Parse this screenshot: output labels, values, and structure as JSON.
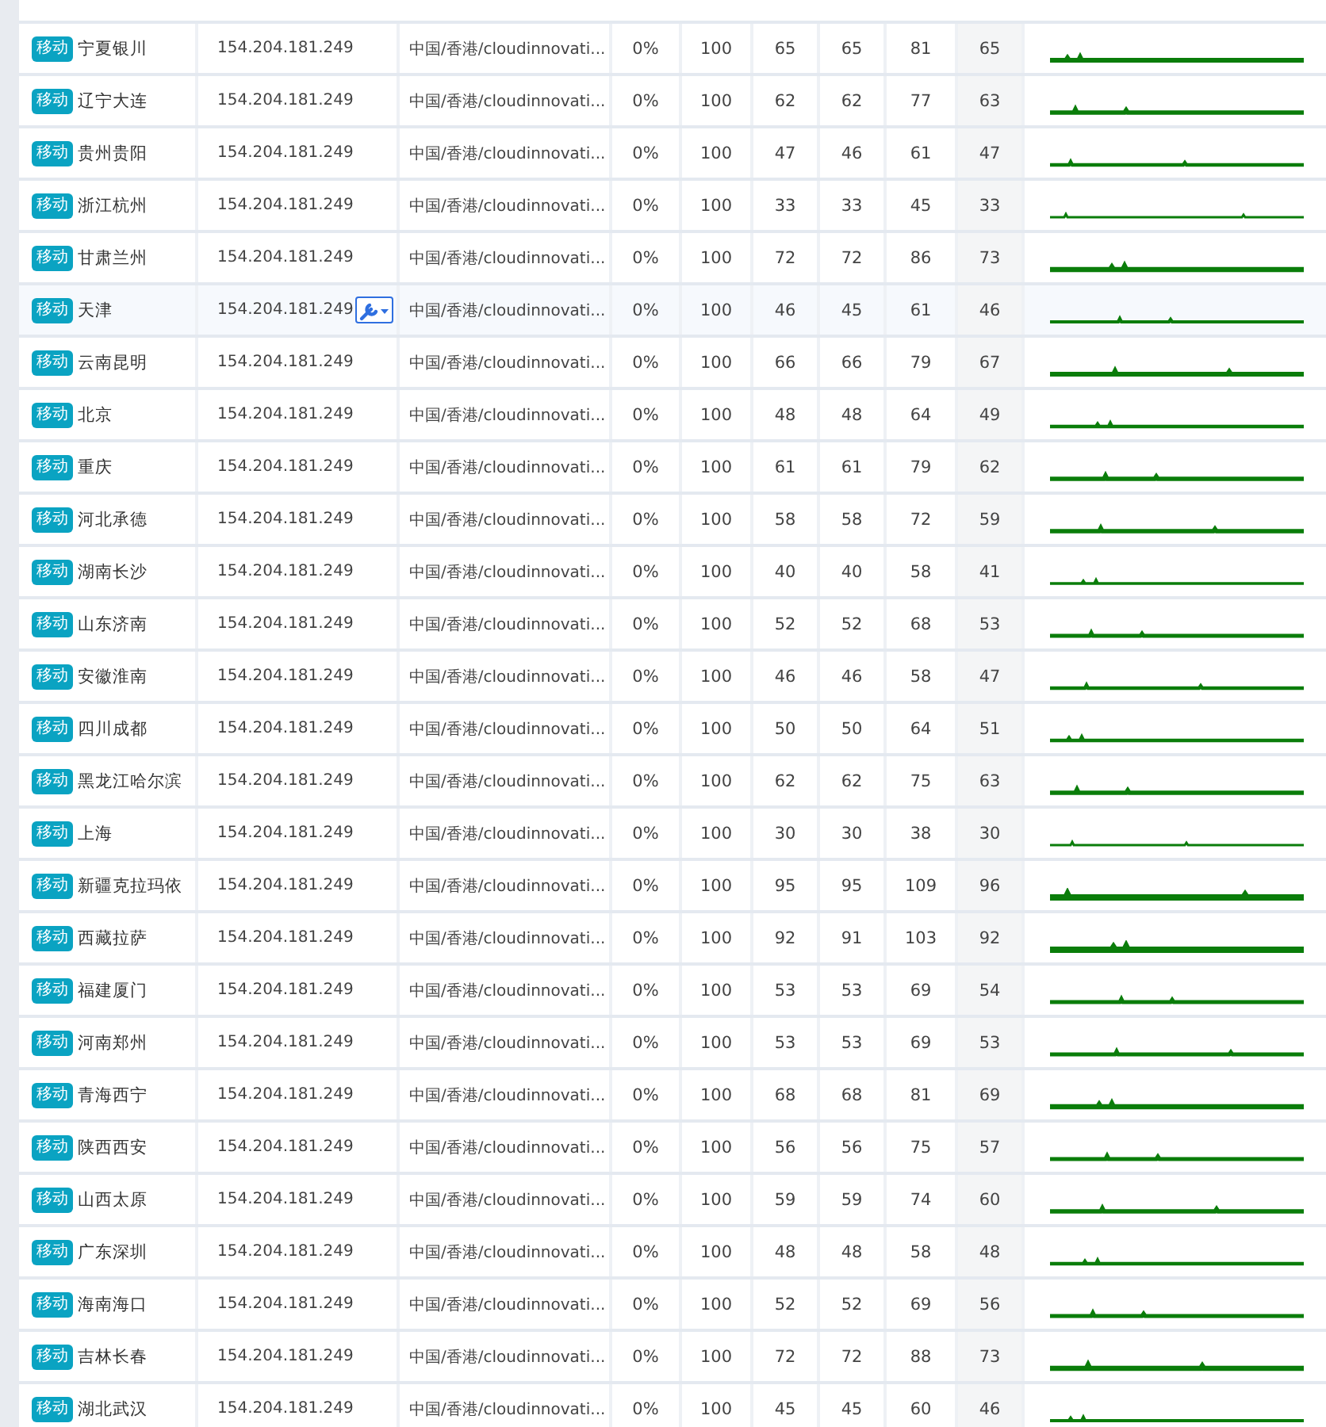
{
  "rows": [
    {
      "carrier": "移动",
      "city": "宁夏银川",
      "ip": "154.204.181.249",
      "location": "中国/香港/cloudinnovati...",
      "values": [
        "0%",
        "100",
        "65",
        "65",
        "81",
        "65"
      ],
      "hovered": false
    },
    {
      "carrier": "移动",
      "city": "辽宁大连",
      "ip": "154.204.181.249",
      "location": "中国/香港/cloudinnovati...",
      "values": [
        "0%",
        "100",
        "62",
        "62",
        "77",
        "63"
      ],
      "hovered": false
    },
    {
      "carrier": "移动",
      "city": "贵州贵阳",
      "ip": "154.204.181.249",
      "location": "中国/香港/cloudinnovati...",
      "values": [
        "0%",
        "100",
        "47",
        "46",
        "61",
        "47"
      ],
      "hovered": false
    },
    {
      "carrier": "移动",
      "city": "浙江杭州",
      "ip": "154.204.181.249",
      "location": "中国/香港/cloudinnovati...",
      "values": [
        "0%",
        "100",
        "33",
        "33",
        "45",
        "33"
      ],
      "hovered": false
    },
    {
      "carrier": "移动",
      "city": "甘肃兰州",
      "ip": "154.204.181.249",
      "location": "中国/香港/cloudinnovati...",
      "values": [
        "0%",
        "100",
        "72",
        "72",
        "86",
        "73"
      ],
      "hovered": false
    },
    {
      "carrier": "移动",
      "city": "天津",
      "ip": "154.204.181.249",
      "location": "中国/香港/cloudinnovati...",
      "values": [
        "0%",
        "100",
        "46",
        "45",
        "61",
        "46"
      ],
      "hovered": true
    },
    {
      "carrier": "移动",
      "city": "云南昆明",
      "ip": "154.204.181.249",
      "location": "中国/香港/cloudinnovati...",
      "values": [
        "0%",
        "100",
        "66",
        "66",
        "79",
        "67"
      ],
      "hovered": false
    },
    {
      "carrier": "移动",
      "city": "北京",
      "ip": "154.204.181.249",
      "location": "中国/香港/cloudinnovati...",
      "values": [
        "0%",
        "100",
        "48",
        "48",
        "64",
        "49"
      ],
      "hovered": false
    },
    {
      "carrier": "移动",
      "city": "重庆",
      "ip": "154.204.181.249",
      "location": "中国/香港/cloudinnovati...",
      "values": [
        "0%",
        "100",
        "61",
        "61",
        "79",
        "62"
      ],
      "hovered": false
    },
    {
      "carrier": "移动",
      "city": "河北承德",
      "ip": "154.204.181.249",
      "location": "中国/香港/cloudinnovati...",
      "values": [
        "0%",
        "100",
        "58",
        "58",
        "72",
        "59"
      ],
      "hovered": false
    },
    {
      "carrier": "移动",
      "city": "湖南长沙",
      "ip": "154.204.181.249",
      "location": "中国/香港/cloudinnovati...",
      "values": [
        "0%",
        "100",
        "40",
        "40",
        "58",
        "41"
      ],
      "hovered": false
    },
    {
      "carrier": "移动",
      "city": "山东济南",
      "ip": "154.204.181.249",
      "location": "中国/香港/cloudinnovati...",
      "values": [
        "0%",
        "100",
        "52",
        "52",
        "68",
        "53"
      ],
      "hovered": false
    },
    {
      "carrier": "移动",
      "city": "安徽淮南",
      "ip": "154.204.181.249",
      "location": "中国/香港/cloudinnovati...",
      "values": [
        "0%",
        "100",
        "46",
        "46",
        "58",
        "47"
      ],
      "hovered": false
    },
    {
      "carrier": "移动",
      "city": "四川成都",
      "ip": "154.204.181.249",
      "location": "中国/香港/cloudinnovati...",
      "values": [
        "0%",
        "100",
        "50",
        "50",
        "64",
        "51"
      ],
      "hovered": false
    },
    {
      "carrier": "移动",
      "city": "黑龙江哈尔滨",
      "ip": "154.204.181.249",
      "location": "中国/香港/cloudinnovati...",
      "values": [
        "0%",
        "100",
        "62",
        "62",
        "75",
        "63"
      ],
      "hovered": false
    },
    {
      "carrier": "移动",
      "city": "上海",
      "ip": "154.204.181.249",
      "location": "中国/香港/cloudinnovati...",
      "values": [
        "0%",
        "100",
        "30",
        "30",
        "38",
        "30"
      ],
      "hovered": false
    },
    {
      "carrier": "移动",
      "city": "新疆克拉玛依",
      "ip": "154.204.181.249",
      "location": "中国/香港/cloudinnovati...",
      "values": [
        "0%",
        "100",
        "95",
        "95",
        "109",
        "96"
      ],
      "hovered": false
    },
    {
      "carrier": "移动",
      "city": "西藏拉萨",
      "ip": "154.204.181.249",
      "location": "中国/香港/cloudinnovati...",
      "values": [
        "0%",
        "100",
        "92",
        "91",
        "103",
        "92"
      ],
      "hovered": false
    },
    {
      "carrier": "移动",
      "city": "福建厦门",
      "ip": "154.204.181.249",
      "location": "中国/香港/cloudinnovati...",
      "values": [
        "0%",
        "100",
        "53",
        "53",
        "69",
        "54"
      ],
      "hovered": false
    },
    {
      "carrier": "移动",
      "city": "河南郑州",
      "ip": "154.204.181.249",
      "location": "中国/香港/cloudinnovati...",
      "values": [
        "0%",
        "100",
        "53",
        "53",
        "69",
        "53"
      ],
      "hovered": false
    },
    {
      "carrier": "移动",
      "city": "青海西宁",
      "ip": "154.204.181.249",
      "location": "中国/香港/cloudinnovati...",
      "values": [
        "0%",
        "100",
        "68",
        "68",
        "81",
        "69"
      ],
      "hovered": false
    },
    {
      "carrier": "移动",
      "city": "陕西西安",
      "ip": "154.204.181.249",
      "location": "中国/香港/cloudinnovati...",
      "values": [
        "0%",
        "100",
        "56",
        "56",
        "75",
        "57"
      ],
      "hovered": false
    },
    {
      "carrier": "移动",
      "city": "山西太原",
      "ip": "154.204.181.249",
      "location": "中国/香港/cloudinnovati...",
      "values": [
        "0%",
        "100",
        "59",
        "59",
        "74",
        "60"
      ],
      "hovered": false
    },
    {
      "carrier": "移动",
      "city": "广东深圳",
      "ip": "154.204.181.249",
      "location": "中国/香港/cloudinnovati...",
      "values": [
        "0%",
        "100",
        "48",
        "48",
        "58",
        "48"
      ],
      "hovered": false
    },
    {
      "carrier": "移动",
      "city": "海南海口",
      "ip": "154.204.181.249",
      "location": "中国/香港/cloudinnovati...",
      "values": [
        "0%",
        "100",
        "52",
        "52",
        "69",
        "56"
      ],
      "hovered": false
    },
    {
      "carrier": "移动",
      "city": "吉林长春",
      "ip": "154.204.181.249",
      "location": "中国/香港/cloudinnovati...",
      "values": [
        "0%",
        "100",
        "72",
        "72",
        "88",
        "73"
      ],
      "hovered": false
    },
    {
      "carrier": "移动",
      "city": "湖北武汉",
      "ip": "154.204.181.249",
      "location": "中国/香港/cloudinnovati...",
      "values": [
        "0%",
        "100",
        "45",
        "45",
        "60",
        "46"
      ],
      "hovered": false
    }
  ]
}
